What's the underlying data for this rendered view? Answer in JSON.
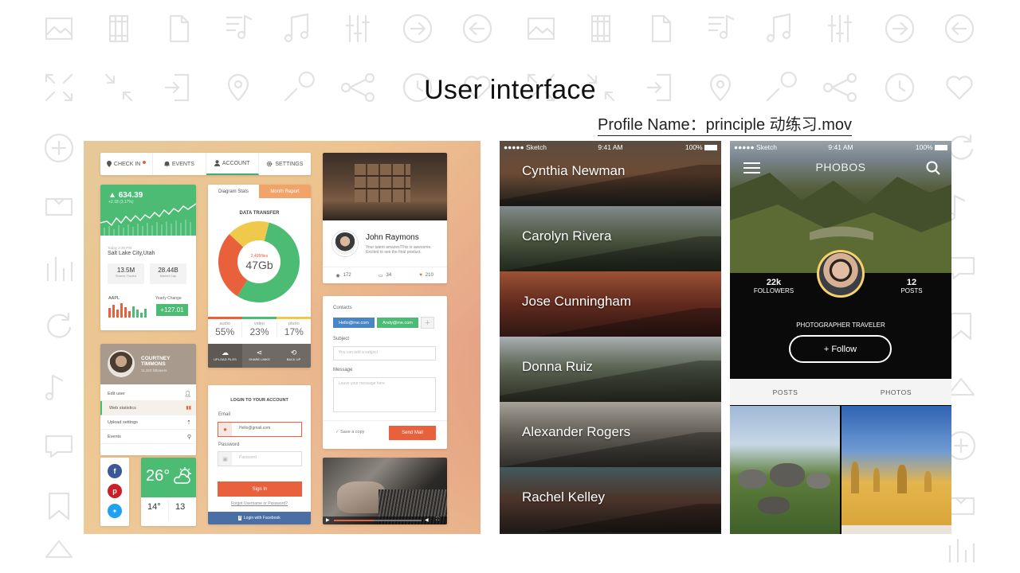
{
  "header": {
    "title": "User interface",
    "subtitle": "Profile Name：principle 动练习.mov"
  },
  "ui_kit": {
    "nav_tabs": [
      {
        "label": "CHECK IN",
        "icon": "pin-icon"
      },
      {
        "label": "EVENTS",
        "icon": "bell-icon"
      },
      {
        "label": "ACCOUNT",
        "icon": "user-icon"
      },
      {
        "label": "SETTINGS",
        "icon": "gear-icon"
      }
    ],
    "stock": {
      "price": "634.39",
      "delta": "+2.18 (3.17%)",
      "date": "Today 2:35 PM",
      "location": "Salt Lake City,Utah",
      "stats": [
        {
          "value": "13.5M",
          "label": "Shares Traded"
        },
        {
          "value": "28.44B",
          "label": "Market Cap"
        }
      ],
      "ticker": "AAPL",
      "change_label": "Yearly Change",
      "change_value": "+127.01"
    },
    "data_transfer": {
      "tabs": [
        "Diagram Stats",
        "Month Report"
      ],
      "title": "DATA TRANSFER",
      "files": "2,495files",
      "total": "47Gb",
      "breakdown": [
        {
          "label": "audio",
          "value": "55%"
        },
        {
          "label": "video",
          "value": "23%"
        },
        {
          "label": "photo",
          "value": "17%"
        }
      ],
      "donut": [
        {
          "share": 0.55,
          "color": "#4cbb74"
        },
        {
          "share": 0.28,
          "color": "#e8603c"
        },
        {
          "share": 0.17,
          "color": "#efc94c"
        }
      ],
      "actions": [
        "UPLOAD FILES",
        "SHARE LINKS",
        "BACK UP"
      ]
    },
    "profile_menu": {
      "name": "COURTNEY TIMMONS",
      "followers": "11,323 followers",
      "items": [
        "Edit user",
        "Web statistics",
        "Upload settings",
        "Events"
      ]
    },
    "photo_card": {
      "name": "John Raymons",
      "bio": "Your talent amazes!This is awesome. Excited to see the final product.",
      "views": "172",
      "comments": "34",
      "likes": "210"
    },
    "contact_form": {
      "contacts_label": "Contacts",
      "chips": [
        "Hello@me.com",
        "Andy@me.com"
      ],
      "subject_label": "Subject",
      "subject_placeholder": "You can add a subject",
      "message_label": "Message",
      "message_placeholder": "Leave your message here",
      "save_label": "Save a copy",
      "send_label": "Send Mail"
    },
    "login": {
      "title": "LOGIN TO YOUR ACCOUNT",
      "email_label": "Email",
      "email_value": "Hello@gmail.com",
      "password_label": "Password",
      "password_placeholder": "Password",
      "signin_label": "Sign In",
      "forgot_label": "Forgot Username or Password?",
      "facebook_label": "Login with Facebook"
    },
    "weather": {
      "temp": "26°",
      "high": "14°",
      "low": "13"
    }
  },
  "phone_list": {
    "status": {
      "carrier": "●●●●● Sketch",
      "time": "9:41 AM",
      "battery": "100%"
    },
    "people": [
      {
        "name": "Cynthia Newman",
        "colors": [
          "#6b5a4c",
          "#9a6a4a",
          "#3d3a34"
        ]
      },
      {
        "name": "Carolyn Rivera",
        "colors": [
          "#9aa3a7",
          "#6d7b5c",
          "#3e4a36"
        ]
      },
      {
        "name": "Jose Cunningham",
        "colors": [
          "#b8613e",
          "#8b3c2a",
          "#5a2a22"
        ]
      },
      {
        "name": "Donna Ruiz",
        "colors": [
          "#c9cfd4",
          "#7f8a72",
          "#555b45"
        ]
      },
      {
        "name": "Alexander Rogers",
        "colors": [
          "#c3bfb4",
          "#8a857a",
          "#5a564e"
        ]
      },
      {
        "name": "Rachel Kelley",
        "colors": [
          "#4d6a6e",
          "#6b4a3c",
          "#3a2e2a"
        ]
      }
    ]
  },
  "phone_profile": {
    "status": {
      "carrier": "●●●●● Sketch",
      "time": "9:41 AM",
      "battery": "100%"
    },
    "title": "PHOBOS",
    "followers_value": "22k",
    "followers_label": "FOLLOWERS",
    "posts_value": "12",
    "posts_label": "POSTS",
    "bio": "PHOTOGRAPHER TRAVELER",
    "follow_label": "+ Follow",
    "tabs": [
      "POSTS",
      "PHOTOS"
    ]
  },
  "colors": {
    "green": "#4cbb74",
    "orange": "#e8603c",
    "yellow": "#efc94c",
    "blue": "#4a86c5"
  }
}
